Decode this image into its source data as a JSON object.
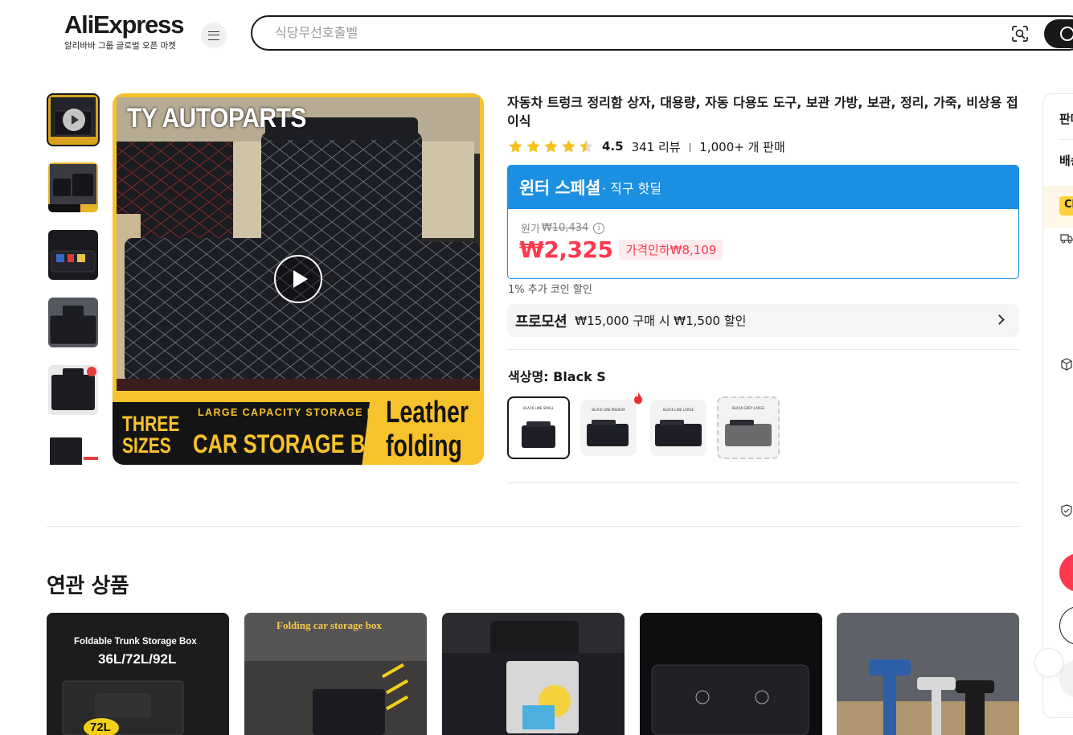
{
  "header": {
    "logo_text": "AliExpress",
    "logo_tagline": "알리바바 그룹 글로벌 오픈 마켓",
    "menu_icon": "hamburger-icon",
    "search_placeholder": "식당무선호출벨",
    "camera_icon": "camera-search-icon",
    "search_icon": "search-icon"
  },
  "gallery": {
    "main_image_text": {
      "brand": "TY AUTOPARTS",
      "three_sizes": "THREE SIZES",
      "large_capacity": "LARGE CAPACITY STORAGE BOX",
      "car_storage": "CAR STORAGE BOX",
      "leather": "Leather folding"
    },
    "thumbnail_count_visible": 6,
    "play_icon": "play-icon"
  },
  "product": {
    "title": "자동차 트렁크 정리함 상자, 대용량, 자동 다용도 도구, 보관 가방, 보관, 정리, 가죽, 비상용 접이식",
    "rating": "4.5",
    "stars_filled": 4.5,
    "reviews": "341 리뷰",
    "separator": "|",
    "sold": "1,000+ 개 판매"
  },
  "deal": {
    "title": "윈터 스페셜",
    "subtitle": "· 직구 핫딜",
    "original_label": "원가",
    "original_price": "₩10,434",
    "price": "₩2,325",
    "discount": "가격인하₩8,109",
    "accent_color": "#1b8fe1",
    "price_color": "#fd384f"
  },
  "coin_note": "1% 추가 코인 할인",
  "promotion": {
    "tag": "프로모션",
    "text": "₩15,000 구매 시 ₩1,500 할인",
    "arrow_icon": "chevron-right-icon"
  },
  "color": {
    "label": "색상명: Black S",
    "options": [
      {
        "caption": "BLACK LINE SMALL",
        "selected": true
      },
      {
        "caption": "BLACK LINE MEDIUM",
        "selected": false,
        "hot": true
      },
      {
        "caption": "BLACK LINE LARGE",
        "selected": false
      },
      {
        "caption": "BLACK GREY LARGE",
        "selected": false,
        "unavailable": true
      }
    ]
  },
  "related": {
    "title": "연관 상품",
    "cards": [
      {
        "text1": "Foldable Trunk Storage Box",
        "text2": "36L/72L/92L",
        "badge": "72L"
      },
      {
        "text1": "Folding car storage box"
      },
      {},
      {},
      {}
    ]
  },
  "side_panel": {
    "item1": "판매",
    "item2": "배송",
    "badge": "Ch",
    "icons": [
      "truck-icon",
      "box-icon",
      "shield-check-icon"
    ]
  }
}
